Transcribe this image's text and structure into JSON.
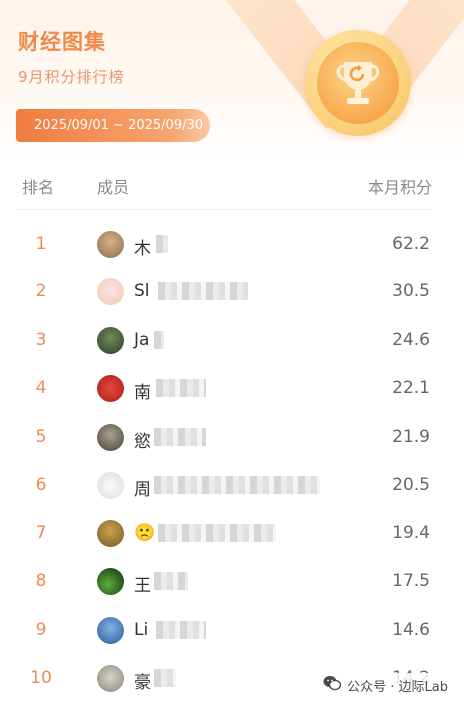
{
  "header": {
    "title": "财经图集",
    "subtitle": "9月积分排行榜",
    "date_range": "2025/09/01 ~ 2025/09/30"
  },
  "table": {
    "col_rank": "排名",
    "col_member": "成员",
    "col_score": "本月积分"
  },
  "rows": [
    {
      "rank": "1",
      "name": "木",
      "score": "62.2"
    },
    {
      "rank": "2",
      "name": "Sl",
      "score": "30.5"
    },
    {
      "rank": "3",
      "name": "Ja",
      "score": "24.6"
    },
    {
      "rank": "4",
      "name": "南",
      "score": "22.1"
    },
    {
      "rank": "5",
      "name": "慾",
      "score": "21.9"
    },
    {
      "rank": "6",
      "name": "周",
      "score": "20.5"
    },
    {
      "rank": "7",
      "name": "🙁",
      "score": "19.4"
    },
    {
      "rank": "8",
      "name": "王",
      "score": "17.5"
    },
    {
      "rank": "9",
      "name": "Li",
      "score": "14.6"
    },
    {
      "rank": "10",
      "name": "豪",
      "score": "14.2"
    }
  ],
  "watermark": {
    "text": "公众号 · 边际Lab",
    "icon": "wechat-icon"
  },
  "colors": {
    "accent": "#f08a4b",
    "rank": "#ef8a56",
    "medal": "#f6bd5c"
  }
}
